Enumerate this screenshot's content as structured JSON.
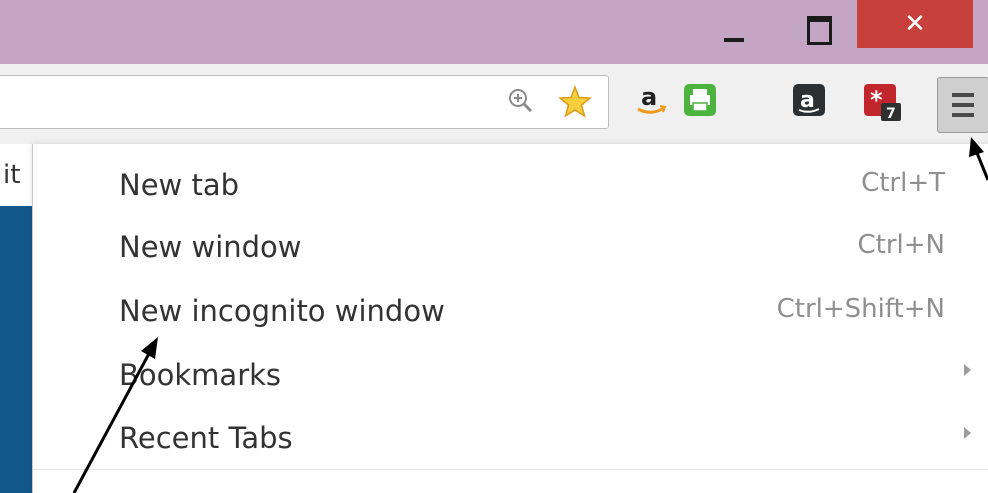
{
  "window": {
    "minimize_icon": "minimize-icon",
    "maximize_icon": "maximize-icon",
    "close_glyph": "✕"
  },
  "toolbar": {
    "icons": [
      "zoom-icon",
      "bookmark-star-icon",
      "amazon-extension-icon",
      "print-friendly-icon",
      "amazon-assistant-icon",
      "lastpass-icon",
      "chrome-menu-icon"
    ],
    "lastpass_badge": "7"
  },
  "page": {
    "partial_text": "it"
  },
  "menu": {
    "items": [
      {
        "label": "New tab",
        "shortcut": "Ctrl+T"
      },
      {
        "label": "New window",
        "shortcut": "Ctrl+N"
      },
      {
        "label": "New incognito window",
        "shortcut": "Ctrl+Shift+N"
      },
      {
        "label": "Bookmarks",
        "shortcut": ""
      },
      {
        "label": "Recent Tabs",
        "shortcut": ""
      }
    ]
  },
  "colors": {
    "titlebar": "#c4a6c4",
    "close_button": "#c7403c",
    "toolbar": "#f0f0f0",
    "page_blue": "#12578a"
  }
}
